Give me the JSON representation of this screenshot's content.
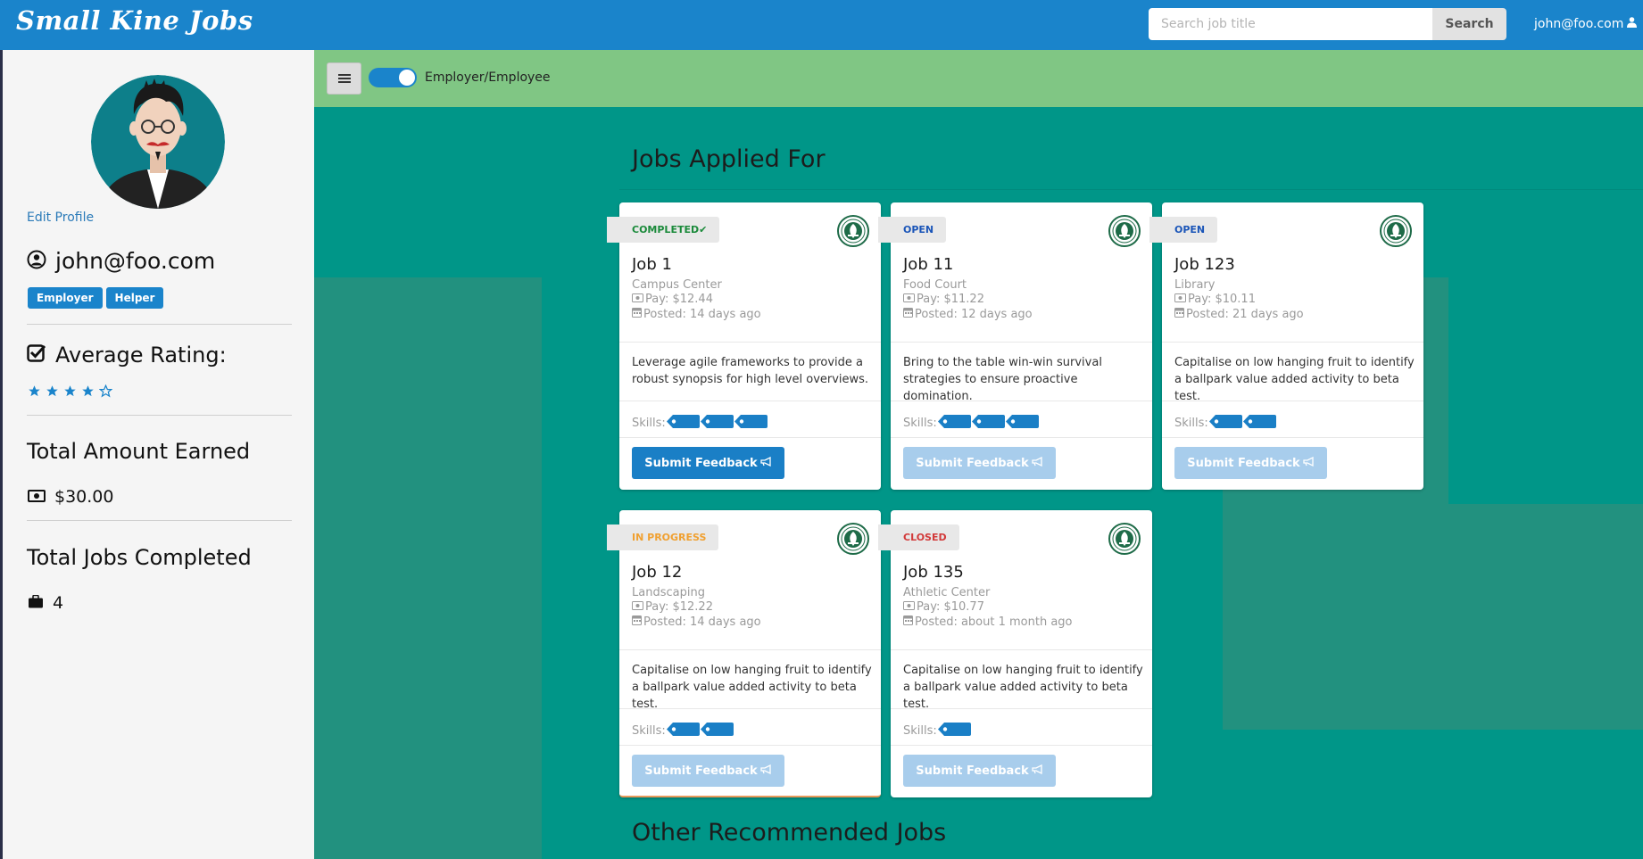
{
  "header": {
    "brand": "Small Kine Jobs",
    "search_placeholder": "Search job title",
    "search_label": "Search",
    "user_email": "john@foo.com"
  },
  "sidebar": {
    "edit_profile": "Edit Profile",
    "username": "john@foo.com",
    "roles": [
      "Employer",
      "Helper"
    ],
    "rating_title": "Average Rating:",
    "rating_stars": 4,
    "rating_max": 5,
    "earned_title": "Total Amount Earned",
    "earned_value": "$30.00",
    "completed_title": "Total Jobs Completed",
    "completed_value": "4"
  },
  "toolbar": {
    "toggle_label": "Employer/Employee",
    "toggle_on": true
  },
  "main": {
    "applied_heading": "Jobs Applied For",
    "recommended_heading": "Other Recommended Jobs",
    "skills_label": "Skills:",
    "feedback_label": "Submit Feedback",
    "jobs": [
      {
        "status": "COMPLETED",
        "status_check": "✔",
        "title": "Job 1",
        "location": "Campus Center",
        "pay": "Pay: $12.44",
        "posted": "Posted: 14 days ago",
        "description": "Leverage agile frameworks to provide a robust synopsis for high level overviews.",
        "skill_count": 3,
        "feedback_enabled": true
      },
      {
        "status": "OPEN",
        "status_check": "",
        "title": "Job 11",
        "location": "Food Court",
        "pay": "Pay: $11.22",
        "posted": "Posted: 12 days ago",
        "description": "Bring to the table win-win survival strategies to ensure proactive domination.",
        "skill_count": 3,
        "feedback_enabled": false
      },
      {
        "status": "OPEN",
        "status_check": "",
        "title": "Job 123",
        "location": "Library",
        "pay": "Pay: $10.11",
        "posted": "Posted: 21 days ago",
        "description": "Capitalise on low hanging fruit to identify a ballpark value added activity to beta test.",
        "skill_count": 2,
        "feedback_enabled": false
      },
      {
        "status": "IN PROGRESS",
        "status_check": "",
        "title": "Job 12",
        "location": "Landscaping",
        "pay": "Pay: $12.22",
        "posted": "Posted: 14 days ago",
        "description": "Capitalise on low hanging fruit to identify a ballpark value added activity to beta test.",
        "skill_count": 2,
        "feedback_enabled": false
      },
      {
        "status": "CLOSED",
        "status_check": "",
        "title": "Job 135",
        "location": "Athletic Center",
        "pay": "Pay: $10.77",
        "posted": "Posted: about 1 month ago",
        "description": "Capitalise on low hanging fruit to identify a ballpark value added activity to beta test.",
        "skill_count": 1,
        "feedback_enabled": false
      }
    ]
  }
}
